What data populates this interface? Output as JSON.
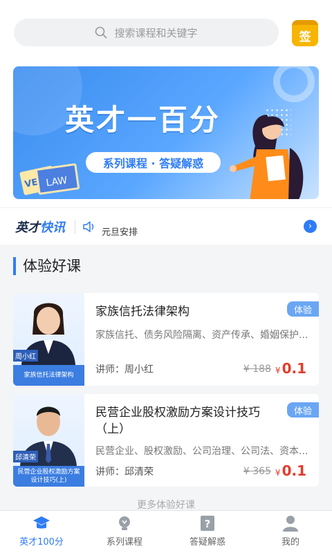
{
  "search": {
    "placeholder": "搜索课程和关键字"
  },
  "sign_label": "签",
  "banner": {
    "title": "英才一百分",
    "subtitle": "系列课程 · 答疑解惑",
    "book_left": "VE",
    "book_right": "LAW"
  },
  "news": {
    "brand_part1": "英才",
    "brand_part2": "快讯",
    "text": "元旦安排"
  },
  "section": {
    "title": "体验好课"
  },
  "courses": [
    {
      "title": "家族信托法律架构",
      "tag": "体验",
      "keywords": "家族信托、债务风险隔离、资产传承、婚姻保护...",
      "lecturer": "讲师：周小红",
      "old_price": "¥ 188",
      "price_symbol": "¥",
      "price": "0.1",
      "thumb_name": "周小红",
      "thumb_caption": "家族信托法律架构"
    },
    {
      "title": "民营企业股权激励方案设计技巧（上）",
      "tag": "体验",
      "keywords": "民营企业、股权激励、公司治理、公司法、资本...",
      "lecturer": "讲师：邱清荣",
      "old_price": "¥ 365",
      "price_symbol": "¥",
      "price": "0.1",
      "thumb_name": "邱清荣",
      "thumb_caption": "民营企业股权激励方案设计技巧(上)"
    }
  ],
  "more_label": "更多体验好课",
  "tabs": [
    {
      "label": "英才100分",
      "icon": "graduation-cap-icon",
      "active": true
    },
    {
      "label": "系列课程",
      "icon": "lightbulb-icon",
      "active": false
    },
    {
      "label": "答疑解惑",
      "icon": "question-icon",
      "active": false
    },
    {
      "label": "我的",
      "icon": "user-icon",
      "active": false
    }
  ],
  "colors": {
    "accent": "#2e7cf6",
    "price": "#e23c2c",
    "sign": "#f7b500"
  }
}
